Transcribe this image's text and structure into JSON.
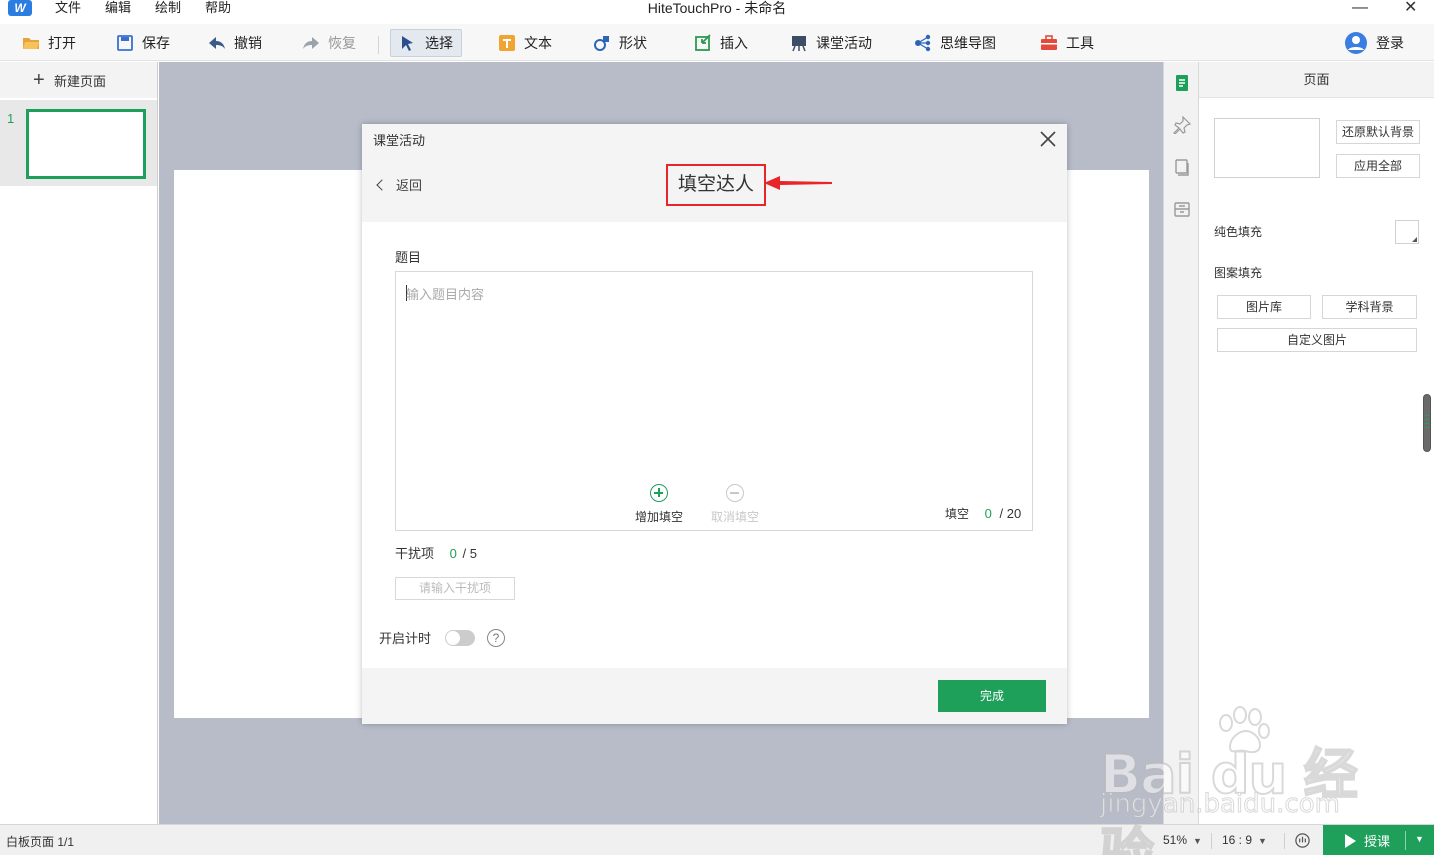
{
  "menu": {
    "items": [
      "文件",
      "编辑",
      "绘制",
      "帮助"
    ],
    "window_title": "HiteTouchPro - 未命名",
    "minimize": "—",
    "close": "✕"
  },
  "toolbar": {
    "open": "打开",
    "save": "保存",
    "undo": "撤销",
    "redo": "恢复",
    "select": "选择",
    "text": "文本",
    "shape": "形状",
    "insert": "插入",
    "class_activity": "课堂活动",
    "mindmap": "思维导图",
    "tools": "工具",
    "login": "登录"
  },
  "left_panel": {
    "new_page": "新建页面",
    "page_number": "1"
  },
  "right_panel": {
    "header": "页面",
    "restore_bg": "还原默认背景",
    "apply_all": "应用全部",
    "solid_fill": "纯色填充",
    "pattern_fill": "图案填充",
    "image_library": "图片库",
    "subject_bg": "学科背景",
    "custom_image": "自定义图片"
  },
  "modal": {
    "title": "课堂活动",
    "back": "返回",
    "activity_name": "填空达人",
    "question_label": "题目",
    "question_placeholder": "输入题目内容",
    "add_blank": "增加填空",
    "cancel_blank": "取消填空",
    "blank_label": "填空",
    "blank_count": "0",
    "blank_total": "/ 20",
    "distractor_label": "干扰项",
    "distractor_count": "0",
    "distractor_total": "/ 5",
    "distractor_placeholder": "请输入干扰项",
    "timer_label": "开启计时",
    "help": "?",
    "done": "完成"
  },
  "status": {
    "page_info": "白板页面 1/1",
    "zoom": "51%",
    "ratio": "16 : 9",
    "teach": "授课"
  },
  "watermark": {
    "main": "Bai du 经验",
    "sub": "jingyan.baidu.com"
  },
  "colors": {
    "accent_green": "#1ea05a",
    "highlight_red": "#e8262a",
    "canvas_bg": "#b7bcc8"
  }
}
